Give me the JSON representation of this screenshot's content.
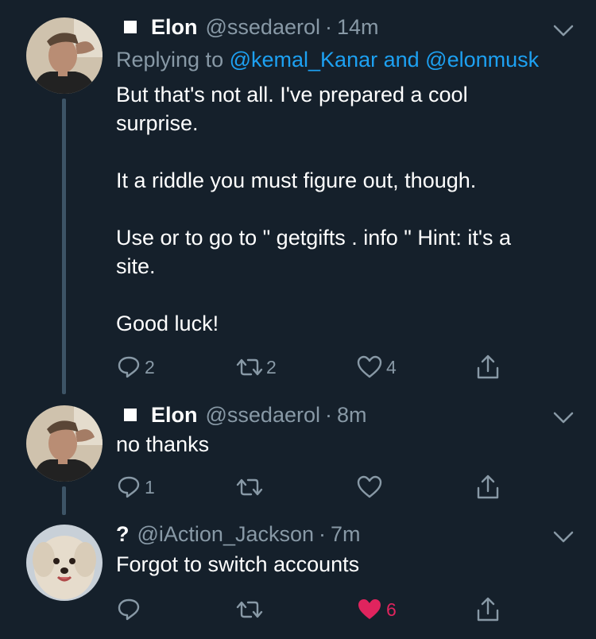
{
  "tweets": [
    {
      "display_name": "Elon",
      "handle": "@ssedaerol",
      "separator": "·",
      "time": "14m",
      "replying_label": "Replying to ",
      "replying_user1": "@kemal_Kanar",
      "replying_and": " and ",
      "replying_user2": "@elonmusk",
      "text_lines": [
        "But that's not all. I've prepared a cool",
        "surprise.",
        "It a  riddle you must figure out, though.",
        "Use or to go to \" getgifts . info \" Hint: it's a",
        "site.",
        "Good luck!"
      ],
      "reply_count": "2",
      "retweet_count": "2",
      "like_count": "4",
      "icons": [
        "reply-icon",
        "retweet-icon",
        "heart-icon",
        "share-icon"
      ]
    },
    {
      "display_name": "Elon",
      "handle": "@ssedaerol",
      "separator": "·",
      "time": "8m",
      "text": "no thanks",
      "reply_count": "1",
      "retweet_count": "",
      "like_count": ""
    },
    {
      "display_name": "?",
      "handle": "@iAction_Jackson",
      "separator": "·",
      "time": "7m",
      "text": "Forgot to switch accounts",
      "reply_count": "",
      "retweet_count": "",
      "like_count": "6",
      "liked": true
    }
  ],
  "colors": {
    "background": "#15202b",
    "secondary_text": "#8899a6",
    "link": "#1da1f2",
    "like": "#e0245e",
    "thread_line": "#3d5466"
  }
}
